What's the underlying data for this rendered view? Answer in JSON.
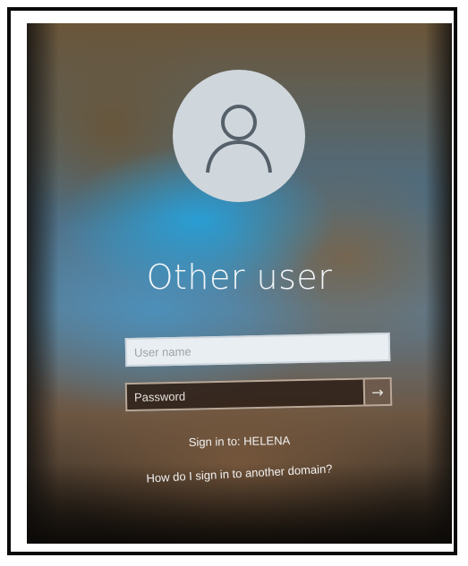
{
  "login": {
    "title": "Other user",
    "username_placeholder": "User name",
    "password_placeholder": "Password",
    "submit_icon": "arrow-right-icon",
    "sign_in_to": "Sign in to: HELENA",
    "other_domain_link": "How do I sign in to another domain?"
  },
  "colors": {
    "avatar_bg": "#cfd6dc",
    "avatar_glyph": "#55606a",
    "text": "#f2f5f7"
  }
}
